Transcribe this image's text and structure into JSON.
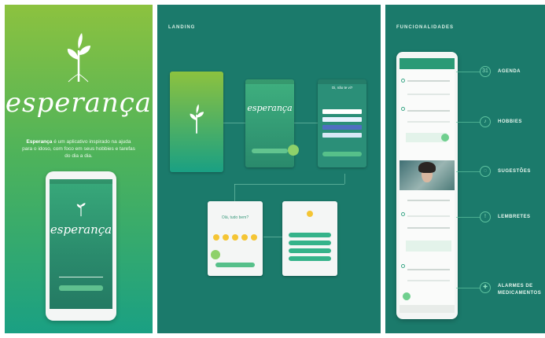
{
  "splash": {
    "logo": "esperança",
    "description_bold": "Esperança",
    "description_rest": " é um aplicativo inspirado na ajuda para o idoso, com foco em seus hobbies e tarefas do dia a dia.",
    "phone_logo": "esperança"
  },
  "landing": {
    "title": "LANDING",
    "greeting": "Olá, tudo bem?",
    "question": "Oi, não te vi?"
  },
  "features": {
    "title": "FUNCIONALIDADES",
    "items": [
      {
        "label": "AGENDA",
        "icon": "calendar-icon",
        "glyph": "31"
      },
      {
        "label": "HOBBIES",
        "icon": "music-icon",
        "glyph": "♪"
      },
      {
        "label": "SUGESTÕES",
        "icon": "lightbulb-icon",
        "glyph": "◌"
      },
      {
        "label": "LEMBRETES",
        "icon": "alarm-icon",
        "glyph": "!"
      },
      {
        "label": "ALARMES DE\nMEDICAMENTOS",
        "icon": "pill-icon",
        "glyph": "✚"
      }
    ]
  },
  "colors": {
    "accent": "#1b7a6b",
    "green": "#8cc23f",
    "teal": "#1aa083"
  }
}
